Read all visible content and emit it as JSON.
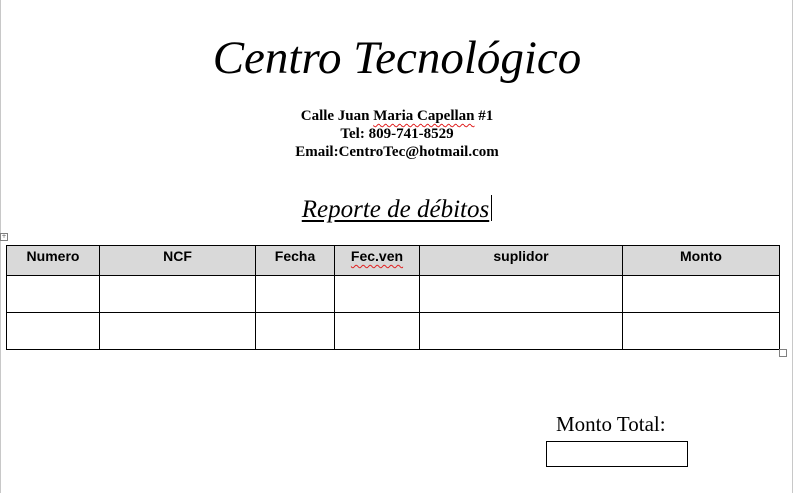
{
  "document": {
    "title": "Centro Tecnológico",
    "address": {
      "street_prefix": "Calle Juan ",
      "street_flagged": "Maria Capellan",
      "street_suffix": " #1",
      "phone": "Tel: 809-741-8529",
      "email": "Email:CentroTec@hotmail.com"
    },
    "report_title": "Reporte de débitos"
  },
  "table": {
    "headers": [
      "Numero",
      "NCF",
      "Fecha",
      "Fec.ven",
      "suplidor",
      "Monto"
    ],
    "rows": [
      [
        "",
        "",
        "",
        "",
        "",
        ""
      ],
      [
        "",
        "",
        "",
        "",
        "",
        ""
      ]
    ]
  },
  "total": {
    "label": "Monto Total:",
    "value": ""
  },
  "colors": {
    "header_fill": "#d9d9d9",
    "spellcheck_underline": "#e02020"
  }
}
